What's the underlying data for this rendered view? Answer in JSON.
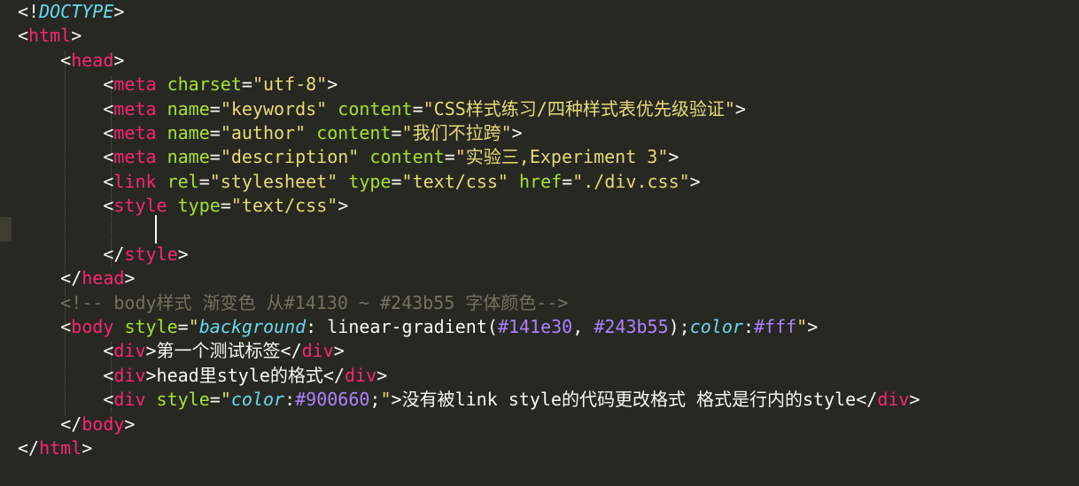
{
  "editor": {
    "theme": {
      "background": "#272822",
      "punctuation": "#f8f8f2",
      "tag": "#f92672",
      "attribute": "#a6e22e",
      "string": "#e6db74",
      "doctype": "#66d9ef",
      "comment": "#75715e",
      "number": "#ae81ff"
    },
    "lines": [
      [
        [
          "p",
          "<!"
        ],
        [
          "d",
          "DOCTYPE"
        ],
        [
          "p",
          ">"
        ]
      ],
      [
        [
          "p",
          "<"
        ],
        [
          "t",
          "html"
        ],
        [
          "p",
          ">"
        ]
      ],
      [
        [
          "p",
          "    <"
        ],
        [
          "t",
          "head"
        ],
        [
          "p",
          ">"
        ]
      ],
      [
        [
          "p",
          "        <"
        ],
        [
          "t",
          "meta"
        ],
        [
          "p",
          " "
        ],
        [
          "a",
          "charset"
        ],
        [
          "p",
          "="
        ],
        [
          "s",
          "\"utf-8\""
        ],
        [
          "p",
          ">"
        ]
      ],
      [
        [
          "p",
          "        <"
        ],
        [
          "t",
          "meta"
        ],
        [
          "p",
          " "
        ],
        [
          "a",
          "name"
        ],
        [
          "p",
          "="
        ],
        [
          "s",
          "\"keywords\""
        ],
        [
          "p",
          " "
        ],
        [
          "a",
          "content"
        ],
        [
          "p",
          "="
        ],
        [
          "s",
          "\"CSS样式练习/四种样式表优先级验证\""
        ],
        [
          "p",
          ">"
        ]
      ],
      [
        [
          "p",
          "        <"
        ],
        [
          "t",
          "meta"
        ],
        [
          "p",
          " "
        ],
        [
          "a",
          "name"
        ],
        [
          "p",
          "="
        ],
        [
          "s",
          "\"author\""
        ],
        [
          "p",
          " "
        ],
        [
          "a",
          "content"
        ],
        [
          "p",
          "="
        ],
        [
          "s",
          "\"我们不拉跨\""
        ],
        [
          "p",
          ">"
        ]
      ],
      [
        [
          "p",
          "        <"
        ],
        [
          "t",
          "meta"
        ],
        [
          "p",
          " "
        ],
        [
          "a",
          "name"
        ],
        [
          "p",
          "="
        ],
        [
          "s",
          "\"description\""
        ],
        [
          "p",
          " "
        ],
        [
          "a",
          "content"
        ],
        [
          "p",
          "="
        ],
        [
          "s",
          "\"实验三,Experiment 3\""
        ],
        [
          "p",
          ">"
        ]
      ],
      [
        [
          "p",
          "        <"
        ],
        [
          "t",
          "link"
        ],
        [
          "p",
          " "
        ],
        [
          "a",
          "rel"
        ],
        [
          "p",
          "="
        ],
        [
          "s",
          "\"stylesheet\""
        ],
        [
          "p",
          " "
        ],
        [
          "a",
          "type"
        ],
        [
          "p",
          "="
        ],
        [
          "s",
          "\"text/css\""
        ],
        [
          "p",
          " "
        ],
        [
          "a",
          "href"
        ],
        [
          "p",
          "="
        ],
        [
          "s",
          "\"./div.css\""
        ],
        [
          "p",
          ">"
        ]
      ],
      [
        [
          "p",
          "        <"
        ],
        [
          "t",
          "style"
        ],
        [
          "p",
          " "
        ],
        [
          "a",
          "type"
        ],
        [
          "p",
          "="
        ],
        [
          "s",
          "\"text/css\""
        ],
        [
          "p",
          ">"
        ]
      ],
      [
        [
          "p",
          ""
        ]
      ],
      [
        [
          "p",
          "        </"
        ],
        [
          "t",
          "style"
        ],
        [
          "p",
          ">"
        ]
      ],
      [
        [
          "p",
          "    </"
        ],
        [
          "t",
          "head"
        ],
        [
          "p",
          ">"
        ]
      ],
      [
        [
          "c",
          "    <!-- body样式 渐变色 从#14130 ~ #243b55 字体颜色-->"
        ]
      ],
      [
        [
          "p",
          "    <"
        ],
        [
          "t",
          "body"
        ],
        [
          "p",
          " "
        ],
        [
          "a",
          "style"
        ],
        [
          "p",
          "="
        ],
        [
          "s",
          "\""
        ],
        [
          "pr",
          "background"
        ],
        [
          "p",
          ": "
        ],
        [
          "cn",
          "linear-gradient"
        ],
        [
          "p",
          "("
        ],
        [
          "n",
          "#141e30"
        ],
        [
          "p",
          ", "
        ],
        [
          "n",
          "#243b55"
        ],
        [
          "p",
          ");"
        ],
        [
          "pr",
          "color"
        ],
        [
          "p",
          ":"
        ],
        [
          "n",
          "#fff"
        ],
        [
          "s",
          "\""
        ],
        [
          "p",
          ">"
        ]
      ],
      [
        [
          "p",
          "        <"
        ],
        [
          "t",
          "div"
        ],
        [
          "p",
          ">"
        ],
        [
          "p",
          "第一个测试标签"
        ],
        [
          "p",
          "</"
        ],
        [
          "t",
          "div"
        ],
        [
          "p",
          ">"
        ]
      ],
      [
        [
          "p",
          "        <"
        ],
        [
          "t",
          "div"
        ],
        [
          "p",
          ">"
        ],
        [
          "p",
          "head里style的格式"
        ],
        [
          "p",
          "</"
        ],
        [
          "t",
          "div"
        ],
        [
          "p",
          ">"
        ]
      ],
      [
        [
          "p",
          "        <"
        ],
        [
          "t",
          "div"
        ],
        [
          "p",
          " "
        ],
        [
          "a",
          "style"
        ],
        [
          "p",
          "="
        ],
        [
          "s",
          "\""
        ],
        [
          "pr",
          "color"
        ],
        [
          "p",
          ":"
        ],
        [
          "n",
          "#900660"
        ],
        [
          "p",
          ";"
        ],
        [
          "s",
          "\""
        ],
        [
          "p",
          ">"
        ],
        [
          "p",
          "没有被link style的代码更改格式 格式是行内的style"
        ],
        [
          "p",
          "</"
        ],
        [
          "t",
          "div"
        ],
        [
          "p",
          ">"
        ]
      ],
      [
        [
          "p",
          "    </"
        ],
        [
          "t",
          "body"
        ],
        [
          "p",
          ">"
        ]
      ],
      [
        [
          "p",
          "</"
        ],
        [
          "t",
          "html"
        ],
        [
          "p",
          ">"
        ]
      ]
    ]
  }
}
